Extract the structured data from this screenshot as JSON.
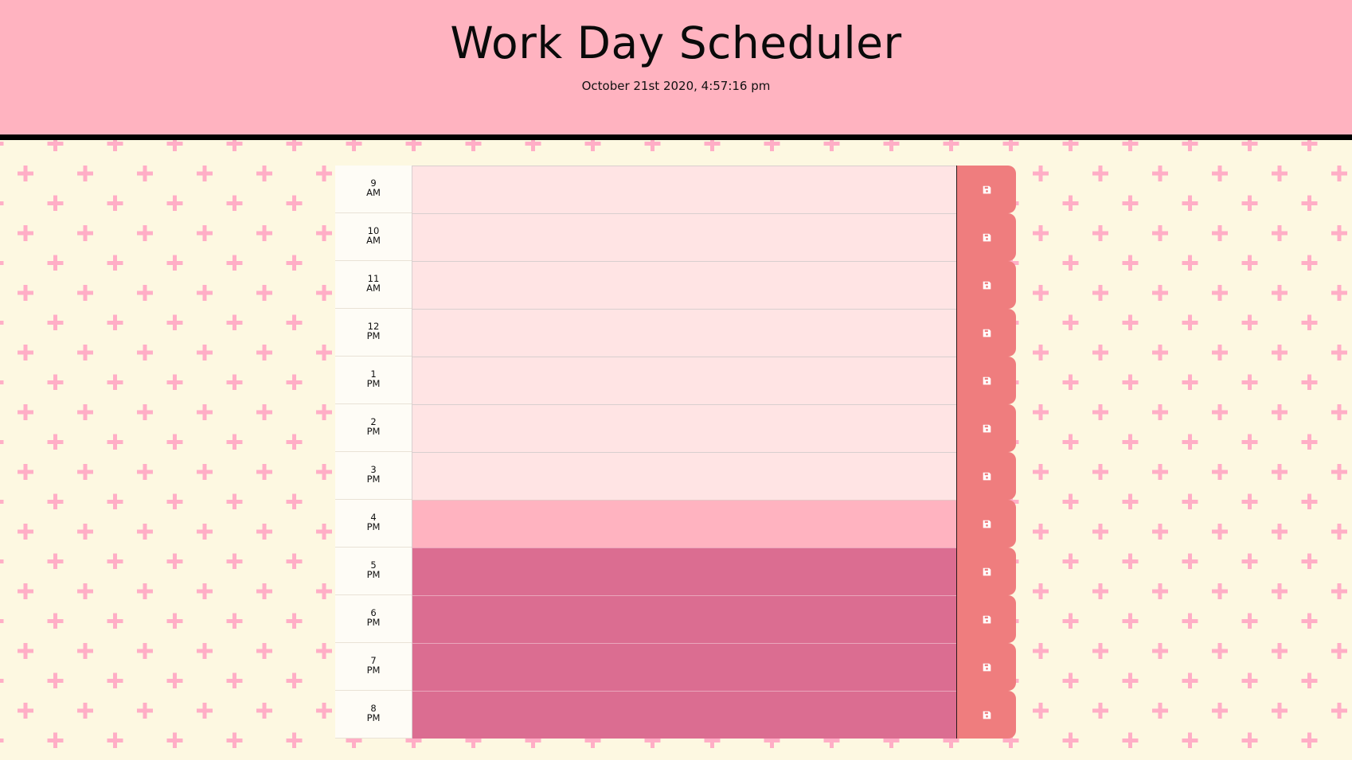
{
  "header": {
    "title": "Work Day Scheduler",
    "date": "October 21st 2020, 4:57:16 pm"
  },
  "colors": {
    "past": "#ffe4e4",
    "present": "#ffb3c0",
    "future": "#db6d91",
    "save_button": "#ef7d7e",
    "header_bg": "#ffb3c0",
    "page_bg": "#fdf8e1",
    "pattern": "#ffaec6"
  },
  "icons": {
    "save": "floppy-disk-icon"
  },
  "rows": [
    {
      "hour": "9",
      "period": "AM",
      "status": "past",
      "text": ""
    },
    {
      "hour": "10",
      "period": "AM",
      "status": "past",
      "text": ""
    },
    {
      "hour": "11",
      "period": "AM",
      "status": "past",
      "text": ""
    },
    {
      "hour": "12",
      "period": "PM",
      "status": "past",
      "text": ""
    },
    {
      "hour": "1",
      "period": "PM",
      "status": "past",
      "text": ""
    },
    {
      "hour": "2",
      "period": "PM",
      "status": "past",
      "text": ""
    },
    {
      "hour": "3",
      "period": "PM",
      "status": "past",
      "text": ""
    },
    {
      "hour": "4",
      "period": "PM",
      "status": "present",
      "text": ""
    },
    {
      "hour": "5",
      "period": "PM",
      "status": "future",
      "text": ""
    },
    {
      "hour": "6",
      "period": "PM",
      "status": "future",
      "text": ""
    },
    {
      "hour": "7",
      "period": "PM",
      "status": "future",
      "text": ""
    },
    {
      "hour": "8",
      "period": "PM",
      "status": "future",
      "text": ""
    }
  ]
}
